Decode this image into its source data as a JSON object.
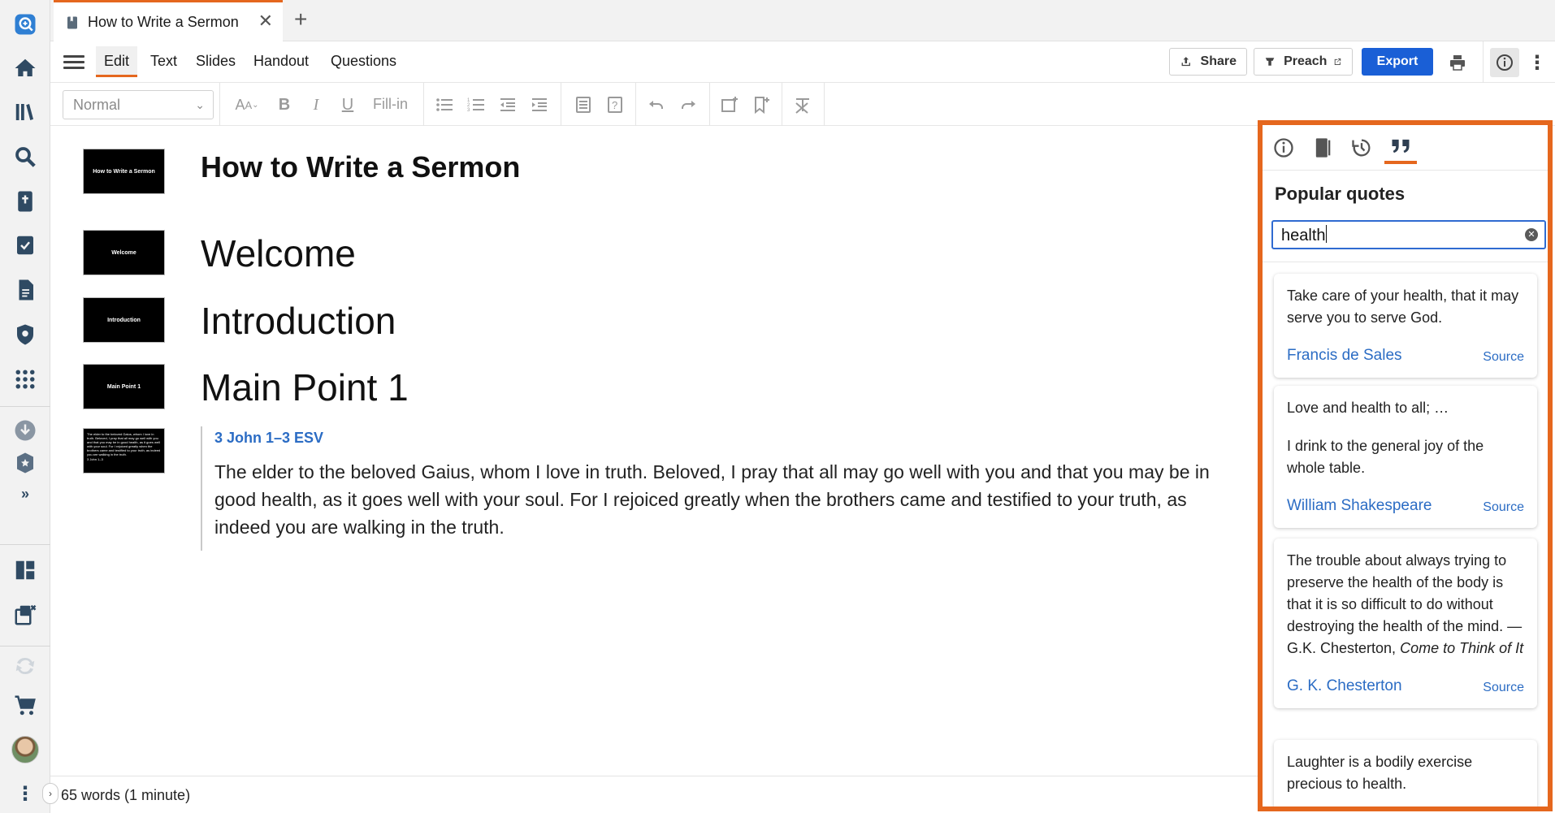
{
  "tab": {
    "title": "How to Write a Sermon"
  },
  "menu": {
    "items": [
      "Edit",
      "Text",
      "Slides",
      "Handout",
      "Questions"
    ],
    "share_label": "Share",
    "preach_label": "Preach",
    "export_label": "Export"
  },
  "toolbar": {
    "style_value": "Normal",
    "fillin_label": "Fill-in"
  },
  "document": {
    "title": "How to Write a Sermon",
    "thumb_title": "How to Write a Sermon",
    "slides": [
      {
        "heading": "Welcome",
        "thumb": "Welcome"
      },
      {
        "heading": "Introduction",
        "thumb": "Introduction"
      },
      {
        "heading": "Main Point 1",
        "thumb": "Main Point 1"
      }
    ],
    "scripture": {
      "reference": "3 John 1–3 ESV",
      "text": "The elder to the beloved Gaius, whom I love in truth. Beloved, I pray that all may go well with you and that you may be in good health, as it goes well with your soul. For I rejoiced greatly when the brothers came and testified to your truth, as indeed you are walking in the truth.",
      "thumb_text": "The elder to the beloved Gaius, whom I love in truth. Beloved, I pray that all may go well with you and that you may be in good health, as it goes well with your soul. For I rejoiced greatly when the brothers came and testified to your truth, as indeed you are walking in the truth.",
      "thumb_ref": "3 John 1–3"
    }
  },
  "status": {
    "word_count": "65 words (1 minute)"
  },
  "panel": {
    "title": "Popular quotes",
    "search_value": "health",
    "quotes": [
      {
        "text": "Take care of your health, that it may serve you to serve God.",
        "author": "Francis de Sales",
        "source": "Source"
      },
      {
        "text": "Love and health to all; …",
        "text2": "I drink to the general joy of the whole table.",
        "author": "William Shakespeare",
        "source": "Source"
      },
      {
        "text": "The trouble about always trying to preserve the health of the body is that it is so difficult to do without destroying the health of the mind. —G.K. Chesterton,",
        "text_italic": "Come to Think of It",
        "author": "G. K. Chesterton",
        "source": "Source"
      },
      {
        "text": "Laughter is a bodily exercise precious to health."
      }
    ]
  },
  "colors": {
    "accent": "#e5671e",
    "primary": "#1a5fd6",
    "link": "#2b6cc4"
  },
  "icons": {
    "rail": [
      "search-logo-icon",
      "home-icon",
      "library-icon",
      "search-icon",
      "bible-icon",
      "checklist-icon",
      "document-icon",
      "shield-icon",
      "apps-icon",
      "download-icon",
      "badge-icon",
      "expand-icon",
      "layout-icon",
      "close-panels-icon",
      "sync-icon",
      "cart-icon",
      "avatar",
      "more-icon"
    ]
  }
}
